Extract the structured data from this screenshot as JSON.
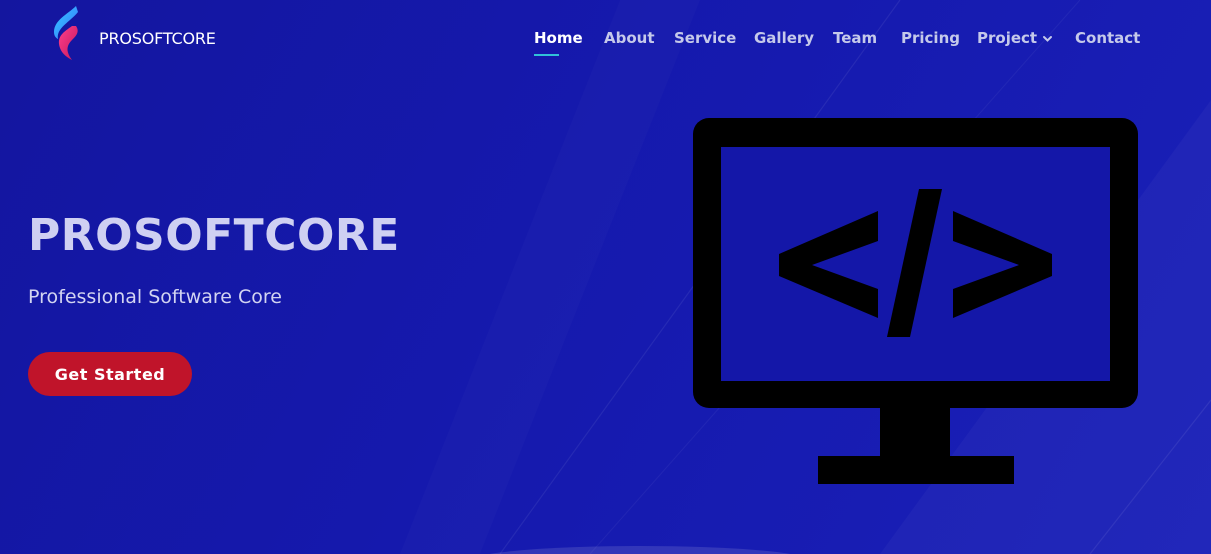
{
  "brand": {
    "name": "PROSOFTCORE",
    "logo_icon": "flame-logo-icon"
  },
  "nav": {
    "items": [
      {
        "label": "Home",
        "active": true
      },
      {
        "label": "About",
        "active": false
      },
      {
        "label": "Service",
        "active": false
      },
      {
        "label": "Gallery",
        "active": false
      },
      {
        "label": "Team",
        "active": false
      },
      {
        "label": "Pricing",
        "active": false
      },
      {
        "label": "Project",
        "active": false,
        "has_dropdown": true
      },
      {
        "label": "Contact",
        "active": false
      }
    ]
  },
  "hero": {
    "title": "PROSOFTCORE",
    "subtitle": "Professional Software Core",
    "cta_label": "Get Started",
    "illustration_icon": "code-monitor-icon"
  },
  "colors": {
    "background": "#1417a8",
    "cta": "#c0142a",
    "active_underline": "#31c2d8",
    "nav_text": "#c5c9ea"
  }
}
